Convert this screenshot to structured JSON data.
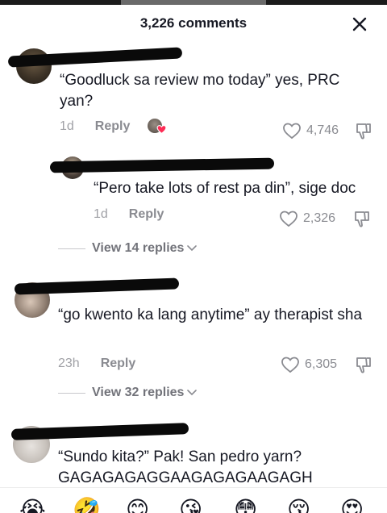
{
  "header": {
    "comment_count": "3,226 comments"
  },
  "comments": [
    {
      "text": "“Goodluck sa review mo today” yes, PRC yan?",
      "time": "1d",
      "reply_label": "Reply",
      "likes": "4,746"
    },
    {
      "text": "“Pero take lots of rest pa din”, sige doc",
      "time": "1d",
      "reply_label": "Reply",
      "likes": "2,326"
    },
    {
      "text": "“go kwento ka lang anytime” ay therapist sha",
      "time": "23h",
      "reply_label": "Reply",
      "likes": "6,305"
    },
    {
      "text": "“Sundo kita?” Pak! San pedro yarn? GAGAGAGAGGAAGAGAGAAGAGH"
    }
  ],
  "view_replies": [
    {
      "label": "View 14 replies"
    },
    {
      "label": "View 32 replies"
    }
  ],
  "emoji_bar": [
    "😭",
    "🤣",
    "😊",
    "😘",
    "😳",
    "😚",
    "😍"
  ],
  "icons": {
    "close": "close-icon",
    "like": "heart-outline-icon",
    "dislike": "thumbs-down-icon",
    "creator_liked": "creator-liked-heart-icon",
    "chevron": "chevron-down-icon"
  },
  "colors": {
    "liked_heart": "#fe2c55",
    "text": "#161823",
    "muted": "#8a8b91"
  }
}
